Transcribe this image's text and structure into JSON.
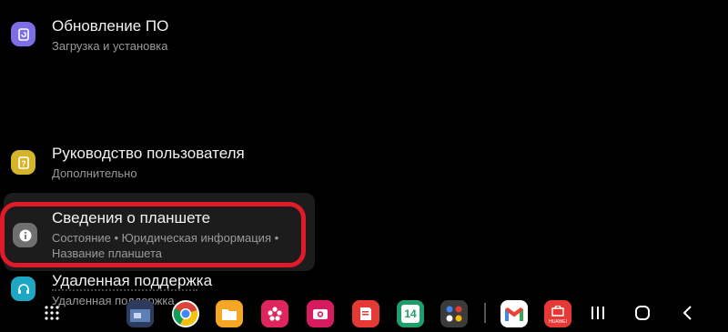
{
  "settings": {
    "items": [
      {
        "title": "Обновление ПО",
        "subtitle": "Загрузка и установка",
        "icon": "software-update-icon",
        "color": "#7d6ee8"
      },
      {
        "title": "Руководство пользователя",
        "subtitle": "Дополнительно",
        "icon": "user-manual-icon",
        "color": "#d4b429"
      },
      {
        "title": "Удаленная поддержка",
        "subtitle": "Удаленная поддержка",
        "icon": "headset-icon",
        "color": "#1ea7c4"
      }
    ],
    "about": {
      "title": "Сведения о планшете",
      "subtitle": "Состояние • Юридическая информация • Название планшета",
      "icon": "info-icon",
      "color": "#6f6f6f"
    },
    "highlight_color": "#e11a28"
  },
  "taskbar": {
    "apps": [
      {
        "name": "photo-app-icon",
        "label": ""
      },
      {
        "name": "chrome-icon",
        "label": ""
      },
      {
        "name": "my-files-icon",
        "label": ""
      },
      {
        "name": "flower-app-icon",
        "label": ""
      },
      {
        "name": "camera-icon",
        "label": ""
      },
      {
        "name": "notes-icon",
        "label": ""
      },
      {
        "name": "calendar-icon",
        "label": "14"
      },
      {
        "name": "app-folder-icon",
        "label": ""
      },
      {
        "name": "gmail-icon",
        "label": ""
      },
      {
        "name": "huawei-appgallery-icon",
        "label": "HUAWEI"
      }
    ]
  }
}
